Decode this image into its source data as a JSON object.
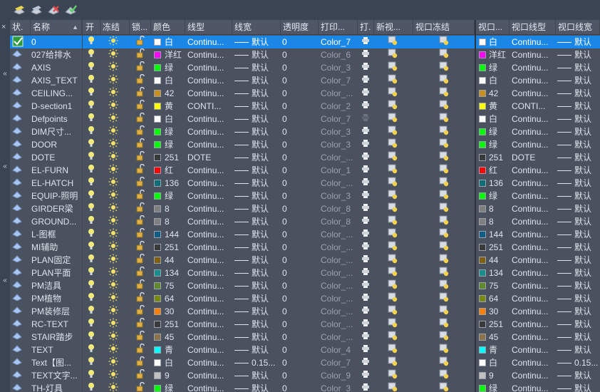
{
  "toolbar": {
    "buttons": [
      {
        "name": "new-layer-icon",
        "color": "#e8d34a"
      },
      {
        "name": "new-layer-vp-frozen-icon",
        "color": "#b8c3d6"
      },
      {
        "name": "delete-layer-icon",
        "color": "#e24b4b"
      },
      {
        "name": "set-current-icon",
        "color": "#5ad16a"
      }
    ]
  },
  "sidebar": {
    "close_glyph": "×",
    "arrow_glyph": "«"
  },
  "header": {
    "status": "状.",
    "name": "名称",
    "sort_arrow": "▲",
    "on": "开",
    "freeze": "冻结",
    "lock": "锁...",
    "color": "颜色",
    "linetype": "线型",
    "lineweight": "线宽",
    "transparency": "透明度",
    "plotstyle": "打印...",
    "plot": "打.",
    "newvp": "新视...",
    "vpfreeze": "视口冻结",
    "vpcolor": "视口...",
    "vplinetype": "视口线型",
    "vplineweight": "视口线宽"
  },
  "lw_default": "默认",
  "transparency_default": "0",
  "layers": [
    {
      "name": "0",
      "color_name": "白",
      "hex": "#ffffff",
      "linetype": "Continu...",
      "lw": "默认",
      "plotstyle": "Color_7",
      "selected": true,
      "current": true
    },
    {
      "name": "027给排水",
      "color_name": "洋红",
      "hex": "#ff00ff",
      "linetype": "Continu...",
      "lw": "默认",
      "plotstyle": "Color_6"
    },
    {
      "name": "AXIS",
      "color_name": "绿",
      "hex": "#00ff00",
      "linetype": "Continu...",
      "lw": "默认",
      "plotstyle": "Color_3"
    },
    {
      "name": "AXIS_TEXT",
      "color_name": "白",
      "hex": "#ffffff",
      "linetype": "Continu...",
      "lw": "默认",
      "plotstyle": "Color_7"
    },
    {
      "name": "CEILING...",
      "color_name": "42",
      "hex": "#c8901a",
      "linetype": "Continu...",
      "lw": "默认",
      "plotstyle": "Color_..."
    },
    {
      "name": "D-section1",
      "color_name": "黄",
      "hex": "#ffff00",
      "linetype": "CONTI...",
      "lw": "默认",
      "plotstyle": "Color_2"
    },
    {
      "name": "Defpoints",
      "color_name": "白",
      "hex": "#ffffff",
      "linetype": "Continu...",
      "lw": "默认",
      "plotstyle": "Color_7",
      "noplot": true
    },
    {
      "name": "DIM尺寸...",
      "color_name": "绿",
      "hex": "#00ff00",
      "linetype": "Continu...",
      "lw": "默认",
      "plotstyle": "Color_3"
    },
    {
      "name": "DOOR",
      "color_name": "绿",
      "hex": "#00ff00",
      "linetype": "Continu...",
      "lw": "默认",
      "plotstyle": "Color_3"
    },
    {
      "name": "DOTE",
      "color_name": "251",
      "hex": "#3a3a3a",
      "linetype": "DOTE",
      "lw": "默认",
      "plotstyle": "Color_..."
    },
    {
      "name": "EL-FURN",
      "color_name": "红",
      "hex": "#ff0000",
      "linetype": "Continu...",
      "lw": "默认",
      "plotstyle": "Color_1"
    },
    {
      "name": "EL-HATCH",
      "color_name": "136",
      "hex": "#0f6f78",
      "linetype": "Continu...",
      "lw": "默认",
      "plotstyle": "Color_..."
    },
    {
      "name": "EQUIP-照明",
      "color_name": "绿",
      "hex": "#00ff00",
      "linetype": "Continu...",
      "lw": "默认",
      "plotstyle": "Color_3"
    },
    {
      "name": "GIRDER梁",
      "color_name": "8",
      "hex": "#808080",
      "linetype": "Continu...",
      "lw": "默认",
      "plotstyle": "Color_8"
    },
    {
      "name": "GROUND...",
      "color_name": "8",
      "hex": "#808080",
      "linetype": "Continu...",
      "lw": "默认",
      "plotstyle": "Color_8"
    },
    {
      "name": "L-图框",
      "color_name": "144",
      "hex": "#0e5e86",
      "linetype": "Continu...",
      "lw": "默认",
      "plotstyle": "Color_..."
    },
    {
      "name": "MI辅助",
      "color_name": "251",
      "hex": "#3a3a3a",
      "linetype": "Continu...",
      "lw": "默认",
      "plotstyle": "Color_..."
    },
    {
      "name": "PLAN固定",
      "color_name": "44",
      "hex": "#806010",
      "linetype": "Continu...",
      "lw": "默认",
      "plotstyle": "Color_..."
    },
    {
      "name": "PLAN平面",
      "color_name": "134",
      "hex": "#1a8c8c",
      "linetype": "Continu...",
      "lw": "默认",
      "plotstyle": "Color_..."
    },
    {
      "name": "PM洁具",
      "color_name": "75",
      "hex": "#5d8a2a",
      "linetype": "Continu...",
      "lw": "默认",
      "plotstyle": "Color_..."
    },
    {
      "name": "PM植物",
      "color_name": "64",
      "hex": "#7a8a10",
      "linetype": "Continu...",
      "lw": "默认",
      "plotstyle": "Color_..."
    },
    {
      "name": "PM装修层",
      "color_name": "30",
      "hex": "#ff7f00",
      "linetype": "Continu...",
      "lw": "默认",
      "plotstyle": "Color_..."
    },
    {
      "name": "RC-TEXT",
      "color_name": "251",
      "hex": "#3a3a3a",
      "linetype": "Continu...",
      "lw": "默认",
      "plotstyle": "Color_..."
    },
    {
      "name": "STAIR踏步",
      "color_name": "45",
      "hex": "#8a7448",
      "linetype": "Continu...",
      "lw": "默认",
      "plotstyle": "Color_..."
    },
    {
      "name": "TEXT",
      "color_name": "青",
      "hex": "#00ffff",
      "linetype": "Continu...",
      "lw": "默认",
      "plotstyle": "Color_4"
    },
    {
      "name": "Text【图...",
      "color_name": "白",
      "hex": "#ffffff",
      "linetype": "Continu...",
      "lw": "0.15...",
      "plotstyle": "Color_7"
    },
    {
      "name": "TEXT文字...",
      "color_name": "9",
      "hex": "#c0c0c0",
      "linetype": "Continu...",
      "lw": "默认",
      "plotstyle": "Color_9"
    },
    {
      "name": "TH-灯具",
      "color_name": "绿",
      "hex": "#00ff00",
      "linetype": "Continu...",
      "lw": "默认",
      "plotstyle": "Color_3"
    }
  ]
}
